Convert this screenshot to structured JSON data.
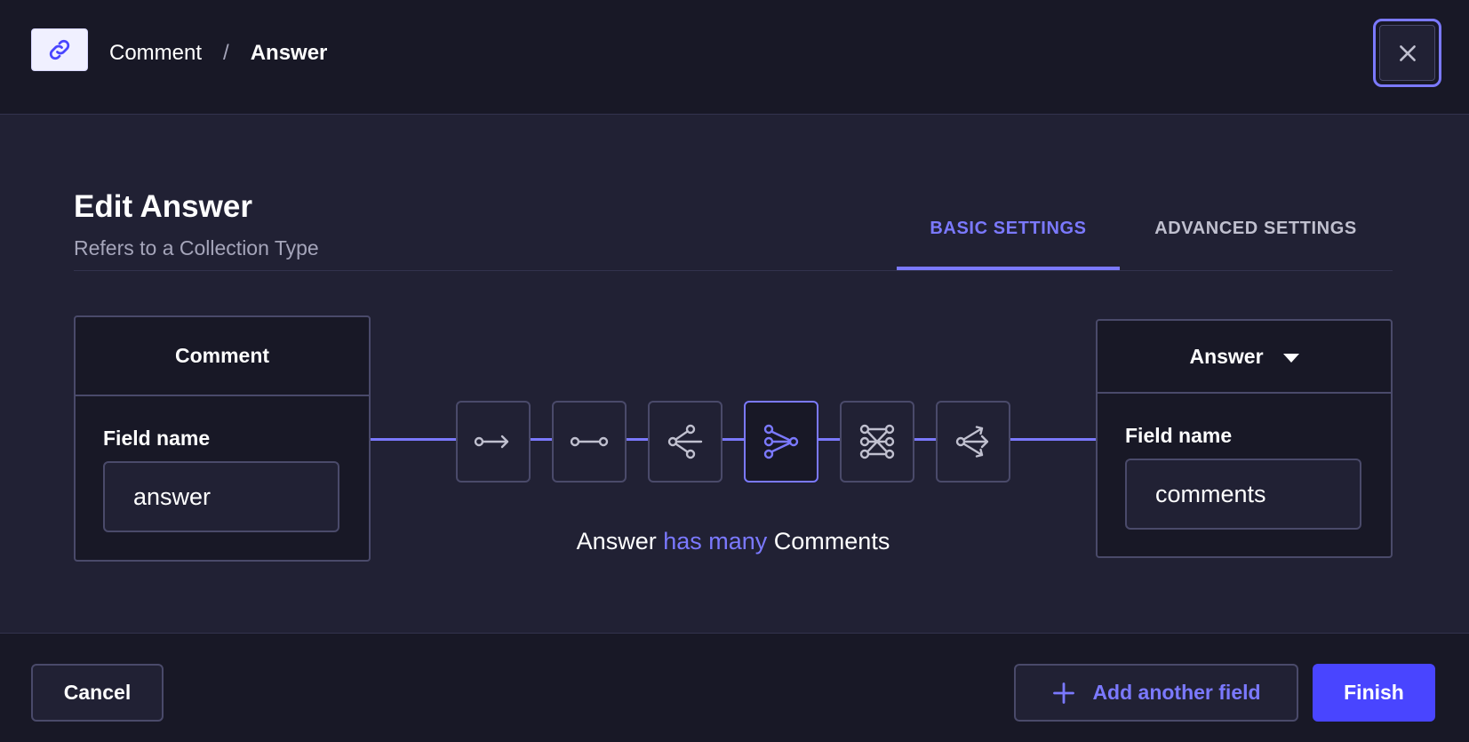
{
  "header": {
    "icon": "link-icon",
    "breadcrumb": [
      {
        "label": "Comment"
      },
      {
        "separator": "/"
      },
      {
        "label": "Answer"
      }
    ],
    "close_icon": "close-icon"
  },
  "title": "Edit Answer",
  "subtitle": "Refers to a Collection Type",
  "tabs": [
    {
      "label": "BASIC SETTINGS",
      "active": true
    },
    {
      "label": "ADVANCED SETTINGS",
      "active": false
    }
  ],
  "left_card": {
    "header": "Comment",
    "field_label": "Field name",
    "field_value": "answer"
  },
  "right_card": {
    "header": "Answer",
    "field_label": "Field name",
    "field_value": "comments",
    "dropdown_icon": "caret-down-icon"
  },
  "relation_types": [
    {
      "icon": "one-way-relation-icon",
      "selected": false
    },
    {
      "icon": "one-to-one-relation-icon",
      "selected": false
    },
    {
      "icon": "one-to-many-relation-icon",
      "selected": false
    },
    {
      "icon": "many-to-one-relation-icon",
      "selected": true
    },
    {
      "icon": "many-to-many-relation-icon",
      "selected": false
    },
    {
      "icon": "many-way-relation-icon",
      "selected": false
    }
  ],
  "relation_description": {
    "subject": "Answer",
    "verb": "has many",
    "object": "Comments"
  },
  "footer": {
    "cancel_label": "Cancel",
    "add_field_label": "Add another field",
    "finish_label": "Finish"
  },
  "colors": {
    "accent": "#7b79ff",
    "primary": "#4945ff",
    "background": "#212134",
    "surface": "#181826",
    "border": "#4a4a6a"
  }
}
